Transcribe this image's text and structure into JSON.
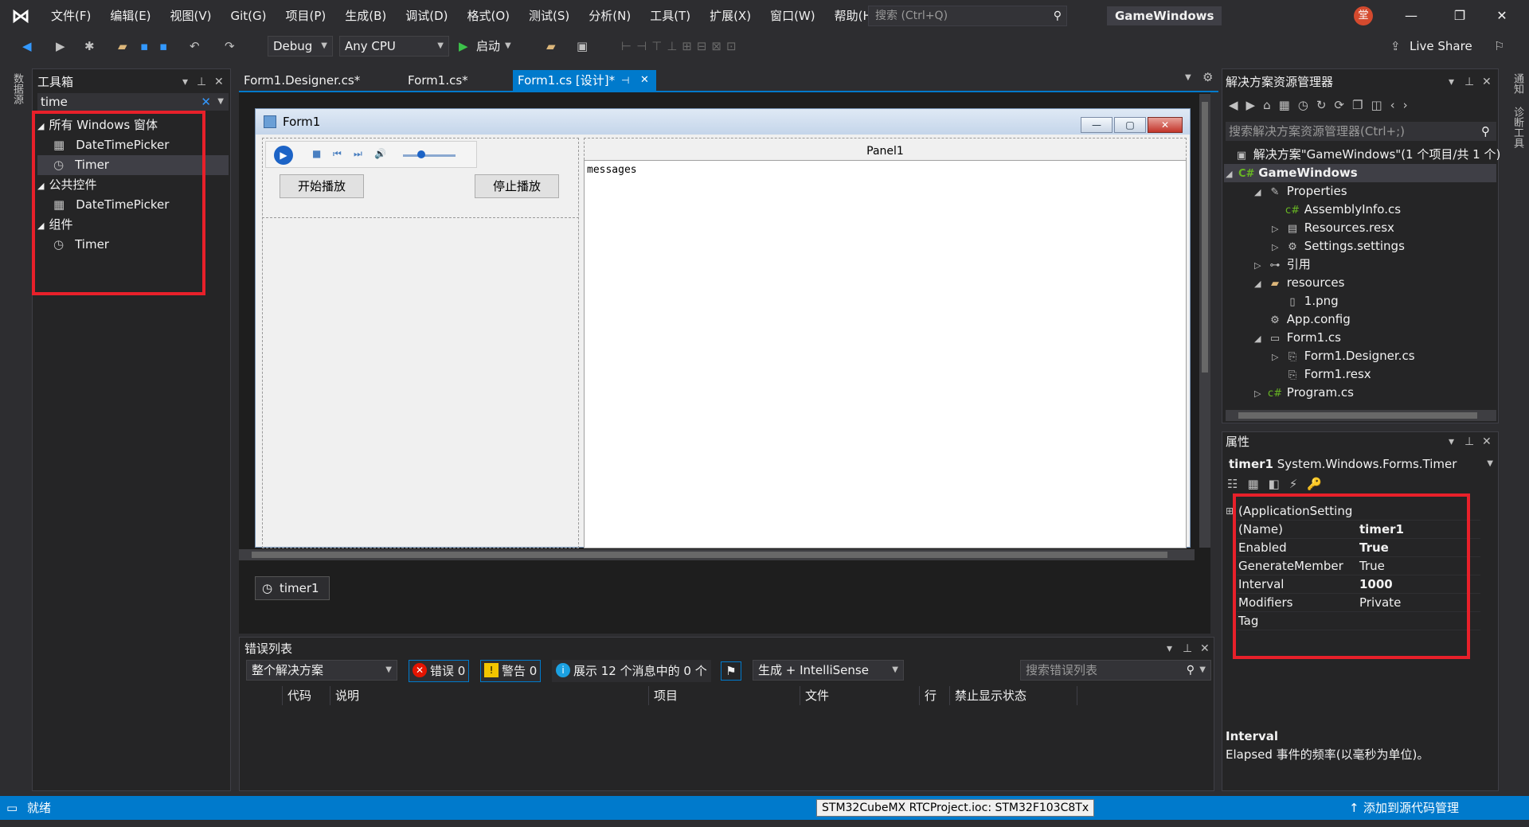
{
  "menu": [
    "文件(F)",
    "编辑(E)",
    "视图(V)",
    "Git(G)",
    "项目(P)",
    "生成(B)",
    "调试(D)",
    "格式(O)",
    "测试(S)",
    "分析(N)",
    "工具(T)",
    "扩展(X)",
    "窗口(W)",
    "帮助(H)"
  ],
  "search": {
    "placeholder": "搜索 (Ctrl+Q)"
  },
  "solution_title": "GameWindows",
  "avatar_text": "堂",
  "toolbar": {
    "config": "Debug",
    "platform": "Any CPU",
    "start_label": "启动",
    "live_share": "Live Share"
  },
  "left_strip_label": "数据源",
  "toolbox": {
    "title": "工具箱",
    "search_value": "time",
    "groups": [
      {
        "label": "所有 Windows 窗体",
        "items": [
          "DateTimePicker",
          "Timer"
        ]
      },
      {
        "label": "公共控件",
        "items": [
          "DateTimePicker"
        ]
      },
      {
        "label": "组件",
        "items": [
          "Timer"
        ]
      }
    ]
  },
  "tabs": [
    {
      "label": "Form1.Designer.cs*",
      "active": false
    },
    {
      "label": "Form1.cs*",
      "active": false
    },
    {
      "label": "Form1.cs [设计]*",
      "active": true
    }
  ],
  "form": {
    "title": "Form1",
    "start_button": "开始播放",
    "stop_button": "停止播放",
    "panel_label": "Panel1",
    "messages_text": "messages"
  },
  "tray": {
    "component": "timer1"
  },
  "error_list": {
    "title": "错误列表",
    "scope": "整个解决方案",
    "errors": "错误 0",
    "warnings": "警告 0",
    "messages": "展示 12 个消息中的 0 个",
    "build_filter": "生成 + IntelliSense",
    "search_placeholder": "搜索错误列表",
    "columns": [
      "代码",
      "说明",
      "项目",
      "文件",
      "行",
      "禁止显示状态"
    ]
  },
  "solution_explorer": {
    "title": "解决方案资源管理器",
    "search_placeholder": "搜索解决方案资源管理器(Ctrl+;)",
    "solution": "解决方案\"GameWindows\"(1 个项目/共 1 个)",
    "project": "GameWindows",
    "items": [
      "Properties",
      "AssemblyInfo.cs",
      "Resources.resx",
      "Settings.settings",
      "引用",
      "resources",
      "1.png",
      "App.config",
      "Form1.cs",
      "Form1.Designer.cs",
      "Form1.resx",
      "Program.cs"
    ]
  },
  "properties": {
    "title": "属性",
    "object_name": "timer1",
    "object_type": "System.Windows.Forms.Timer",
    "rows": [
      {
        "name": "(ApplicationSetting",
        "value": ""
      },
      {
        "name": "(Name)",
        "value": "timer1"
      },
      {
        "name": "Enabled",
        "value": "True"
      },
      {
        "name": "GenerateMember",
        "value": "True"
      },
      {
        "name": "Interval",
        "value": "1000"
      },
      {
        "name": "Modifiers",
        "value": "Private"
      },
      {
        "name": "Tag",
        "value": ""
      }
    ],
    "desc_title": "Interval",
    "desc_text": "Elapsed 事件的频率(以毫秒为单位)。"
  },
  "right_strip_labels": [
    "通知",
    "诊断工具"
  ],
  "status": {
    "ready": "就绪",
    "tooltip": "STM32CubeMX RTCProject.ioc: STM32F103C8Tx",
    "right": "添加到源代码管理"
  },
  "colors": {
    "accent": "#007acc",
    "highlight": "#e8202a",
    "background": "#2d2d30"
  }
}
